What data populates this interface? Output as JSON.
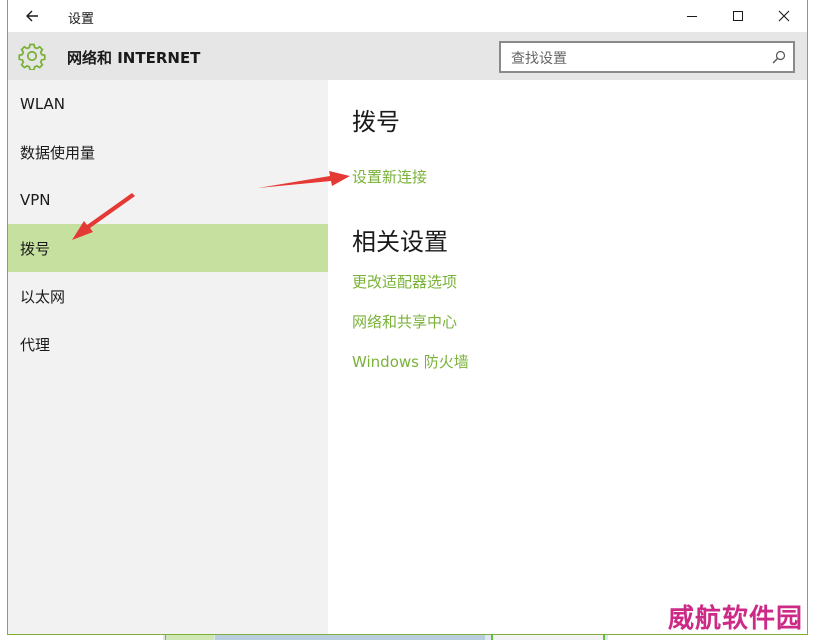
{
  "window": {
    "title": "设置"
  },
  "header": {
    "title": "网络和 INTERNET",
    "icon": "gear-icon",
    "search_placeholder": "查找设置"
  },
  "sidebar": {
    "items": [
      {
        "label": "WLAN",
        "selected": false
      },
      {
        "label": "数据使用量",
        "selected": false
      },
      {
        "label": "VPN",
        "selected": false
      },
      {
        "label": "拨号",
        "selected": true
      },
      {
        "label": "以太网",
        "selected": false
      },
      {
        "label": "代理",
        "selected": false
      }
    ]
  },
  "main": {
    "section_title": "拨号",
    "setup_link": "设置新连接",
    "related_title": "相关设置",
    "related_links": [
      "更改适配器选项",
      "网络和共享中心",
      "Windows 防火墙"
    ]
  },
  "watermark": "威航软件园",
  "colors": {
    "accent": "#7ab23a",
    "selected_bg": "#c6e19f",
    "header_bg": "#e6e6e6",
    "sidebar_bg": "#f2f2f2",
    "annotation_arrow": "#e53935",
    "watermark": "#cc2a86"
  }
}
